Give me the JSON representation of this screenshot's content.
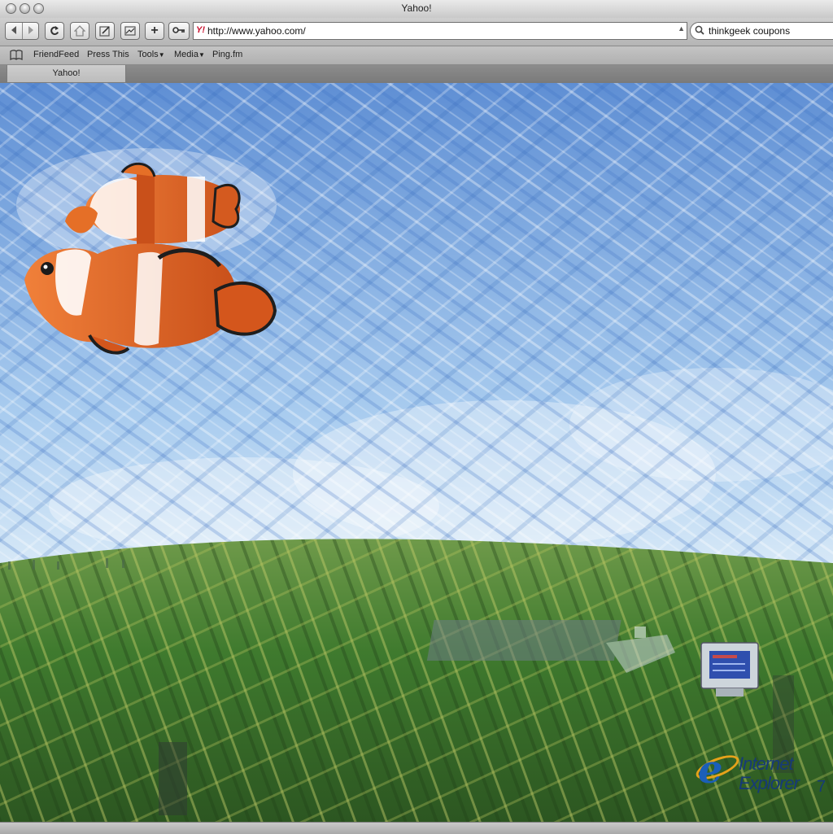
{
  "window": {
    "title": "Yahoo!"
  },
  "toolbar": {
    "back_icon": "back-arrow-icon",
    "forward_icon": "forward-arrow-icon",
    "reload_icon": "reload-icon",
    "home_icon": "home-icon",
    "edit_icon": "edit-icon",
    "snapshot_icon": "snapshot-icon",
    "add_label": "+",
    "key_icon": "key-icon",
    "url": "http://www.yahoo.com/",
    "favicon_label": "Y!",
    "search_query": "thinkgeek coupons"
  },
  "bookmarks": {
    "items": [
      {
        "label": "FriendFeed"
      },
      {
        "label": "Press This"
      },
      {
        "label": "Tools",
        "menu": true
      },
      {
        "label": "Media",
        "menu": true
      },
      {
        "label": "Ping.fm"
      }
    ]
  },
  "tabs": [
    {
      "label": "Yahoo!",
      "active": true
    }
  ],
  "content": {
    "ie_logo_line1": "Internet",
    "ie_logo_line2": "Explorer",
    "ie_logo_version": "7",
    "ie_logo_letter": "e"
  },
  "colors": {
    "sky": "#7fa9de",
    "grass": "#3f7a2e",
    "clownfish_orange": "#e0621c"
  }
}
